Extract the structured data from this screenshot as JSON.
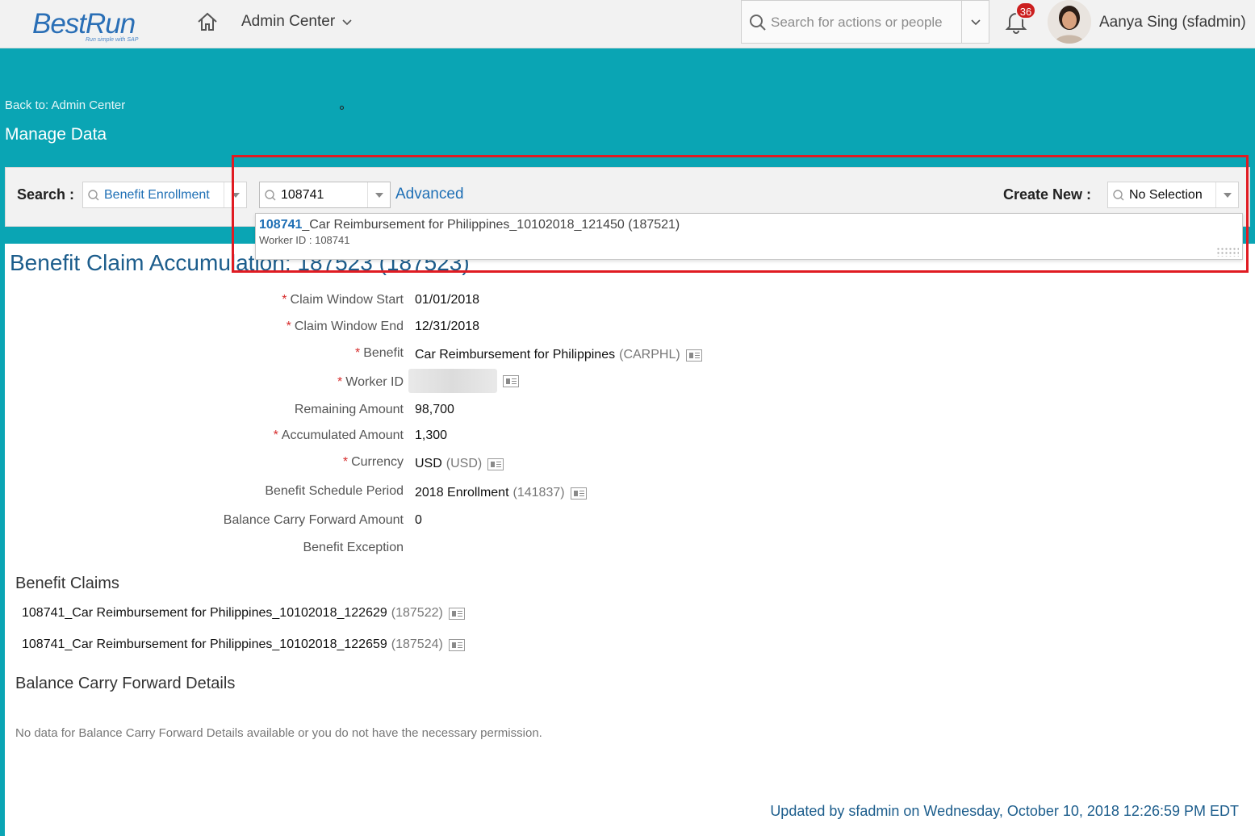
{
  "shell": {
    "logo_text": "BestRun",
    "logo_tagline": "Run simple with SAP",
    "nav_label": "Admin Center",
    "search_placeholder": "Search for actions or people",
    "notification_count": "36",
    "user_name": "Aanya Sing (sfadmin)"
  },
  "header": {
    "back_link": "Back to: Admin Center",
    "title": "Manage Data"
  },
  "toolbar": {
    "search_label": "Search :",
    "object_type": "Benefit Enrollment",
    "search_value": "108741",
    "advanced_label": "Advanced",
    "create_label": "Create New :",
    "create_value": "No Selection"
  },
  "suggestion": {
    "highlight": "108741",
    "rest": "_Car Reimbursement for Philippines_10102018_121450 (187521)",
    "sub": "Worker ID :  108741"
  },
  "record": {
    "title": "Benefit Claim Accumulation: 187523 (187523)",
    "fields": [
      {
        "label": "Claim Window Start",
        "required": "*",
        "value": "01/01/2018"
      },
      {
        "label": "Claim Window End",
        "required": "*",
        "value": "12/31/2018"
      },
      {
        "label": "Benefit",
        "required": "*",
        "value": "Car Reimbursement for Philippines",
        "code": "(CARPHL)"
      },
      {
        "label": "Worker ID",
        "required": "*",
        "value": ""
      },
      {
        "label": "Remaining Amount",
        "required": "",
        "value": "98,700"
      },
      {
        "label": "Accumulated Amount",
        "required": "*",
        "value": "1,300"
      },
      {
        "label": "Currency",
        "required": "*",
        "value": "USD",
        "code": "(USD)"
      },
      {
        "label": "Benefit Schedule Period",
        "required": "",
        "value": "2018 Enrollment",
        "code": "(141837)"
      },
      {
        "label": "Balance Carry Forward Amount",
        "required": "",
        "value": "0"
      },
      {
        "label": "Benefit Exception",
        "required": "",
        "value": ""
      }
    ]
  },
  "claims": {
    "title": "Benefit Claims",
    "items": [
      {
        "name": "108741_Car Reimbursement for Philippines_10102018_122629",
        "id": "(187522)"
      },
      {
        "name": "108741_Car Reimbursement for Philippines_10102018_122659",
        "id": "(187524)"
      }
    ]
  },
  "carry_forward": {
    "title": "Balance Carry Forward Details",
    "message": "No data for Balance Carry Forward Details available or you do not have the necessary permission."
  },
  "footer": {
    "updated": "Updated by sfadmin on Wednesday, October 10, 2018 12:26:59 PM EDT"
  },
  "colors": {
    "header_teal": "#0aa5b4",
    "link_blue": "#1e6fb5",
    "highlight_red": "#e01b22",
    "badge_red": "#cc1f1f"
  }
}
